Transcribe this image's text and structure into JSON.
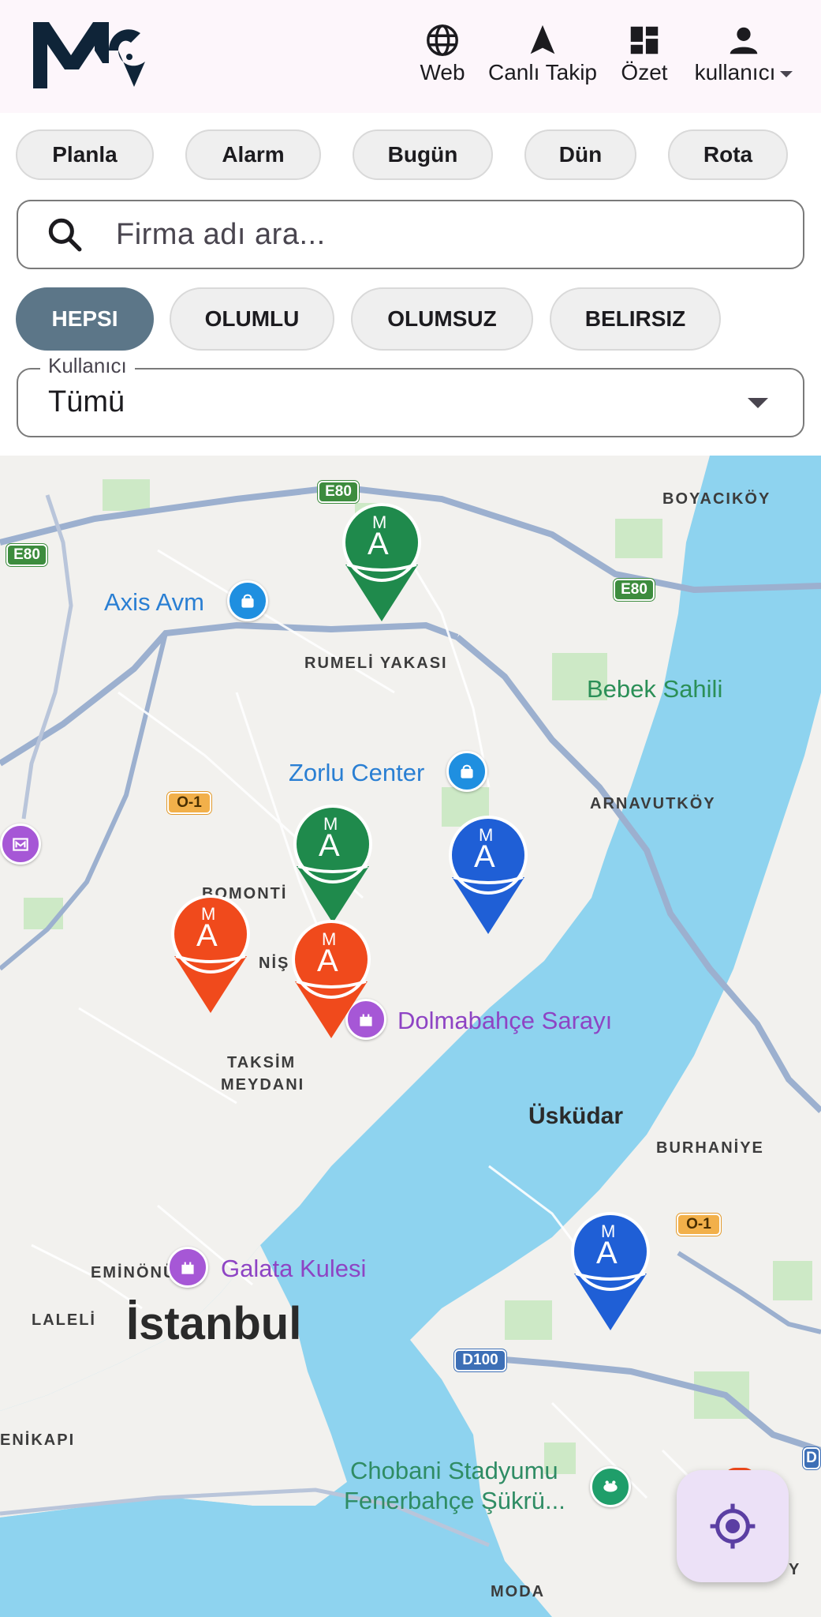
{
  "header": {
    "nav": [
      {
        "label": "Web",
        "icon": "globe-icon"
      },
      {
        "label": "Canlı Takip",
        "icon": "navigation-arrow-icon"
      },
      {
        "label": "Özet",
        "icon": "dashboard-icon"
      },
      {
        "label": "kullanıcı",
        "icon": "person-icon"
      }
    ]
  },
  "filters": [
    "Planla",
    "Alarm",
    "Bugün",
    "Dün",
    "Rota"
  ],
  "search": {
    "placeholder": "Firma adı ara...",
    "value": ""
  },
  "status_chips": {
    "items": [
      "HEPSI",
      "OLUMLU",
      "OLUMSUZ",
      "BELIRSIZ"
    ],
    "selected": "HEPSI"
  },
  "user_dropdown": {
    "label": "Kullanıcı",
    "value": "Tümü"
  },
  "map": {
    "districts": [
      "BOYACIKÖY",
      "RUMELİ YAKASI",
      "ARNAVUTKÖY",
      "BOMONTİ",
      "NİŞ",
      "TAKSİM",
      "MEYDANI",
      "BURHANİYE",
      "EMİNÖNÜ",
      "LALELİ",
      "ENİKAPI",
      "MODA",
      "Y"
    ],
    "cities": {
      "istanbul": "İstanbul",
      "uskudar": "Üsküdar"
    },
    "pois": {
      "axis": "Axis Avm",
      "zorlu": "Zorlu Center",
      "bebek": "Bebek Sahili",
      "dolmabahce": "Dolmabahçe Sarayı",
      "galata": "Galata Kulesi",
      "chobani_1": "Chobani Stadyumu",
      "chobani_2": "Fenerbahçe Şükrü..."
    },
    "roads": {
      "e80": "E80",
      "o1": "O-1",
      "d100": "D100",
      "d_edge": "D"
    },
    "marker_text": {
      "top": "M",
      "bottom": "A"
    },
    "marker_colors": {
      "green": "#1f8a4c",
      "red": "#f04a1c",
      "blue": "#1f5fd6"
    }
  },
  "colors": {
    "accent": "#5c7688",
    "header_bg": "#fdf6fb",
    "fab_bg": "#ece1f7",
    "fab_icon": "#5b3fa3",
    "water": "#8ed3ef"
  }
}
